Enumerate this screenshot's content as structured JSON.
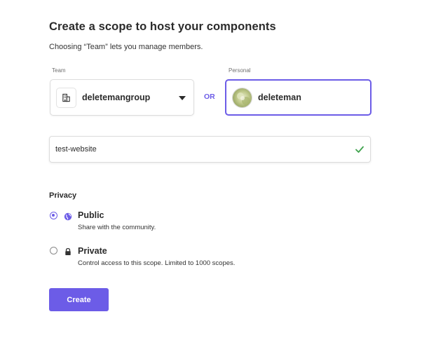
{
  "page": {
    "title": "Create a scope to host your components",
    "subtitle": "Choosing “Team” lets you manage members."
  },
  "owner": {
    "team_label": "Team",
    "team_selected": "deletemangroup",
    "team_icon": "building-icon",
    "or_label": "OR",
    "personal_label": "Personal",
    "personal_name": "deleteman",
    "personal_selected": true
  },
  "scope_name": {
    "value": "test-website",
    "valid_icon": "checkmark-icon"
  },
  "privacy": {
    "title": "Privacy",
    "options": [
      {
        "label": "Public",
        "description": "Share with the community.",
        "icon": "globe-icon",
        "selected": true
      },
      {
        "label": "Private",
        "description": "Control access to this scope. Limited to 1000 scopes.",
        "icon": "lock-icon",
        "selected": false
      }
    ]
  },
  "actions": {
    "create_label": "Create"
  },
  "colors": {
    "accent": "#6c5ce7",
    "success": "#3fa34d",
    "text": "#2b2b2b"
  }
}
